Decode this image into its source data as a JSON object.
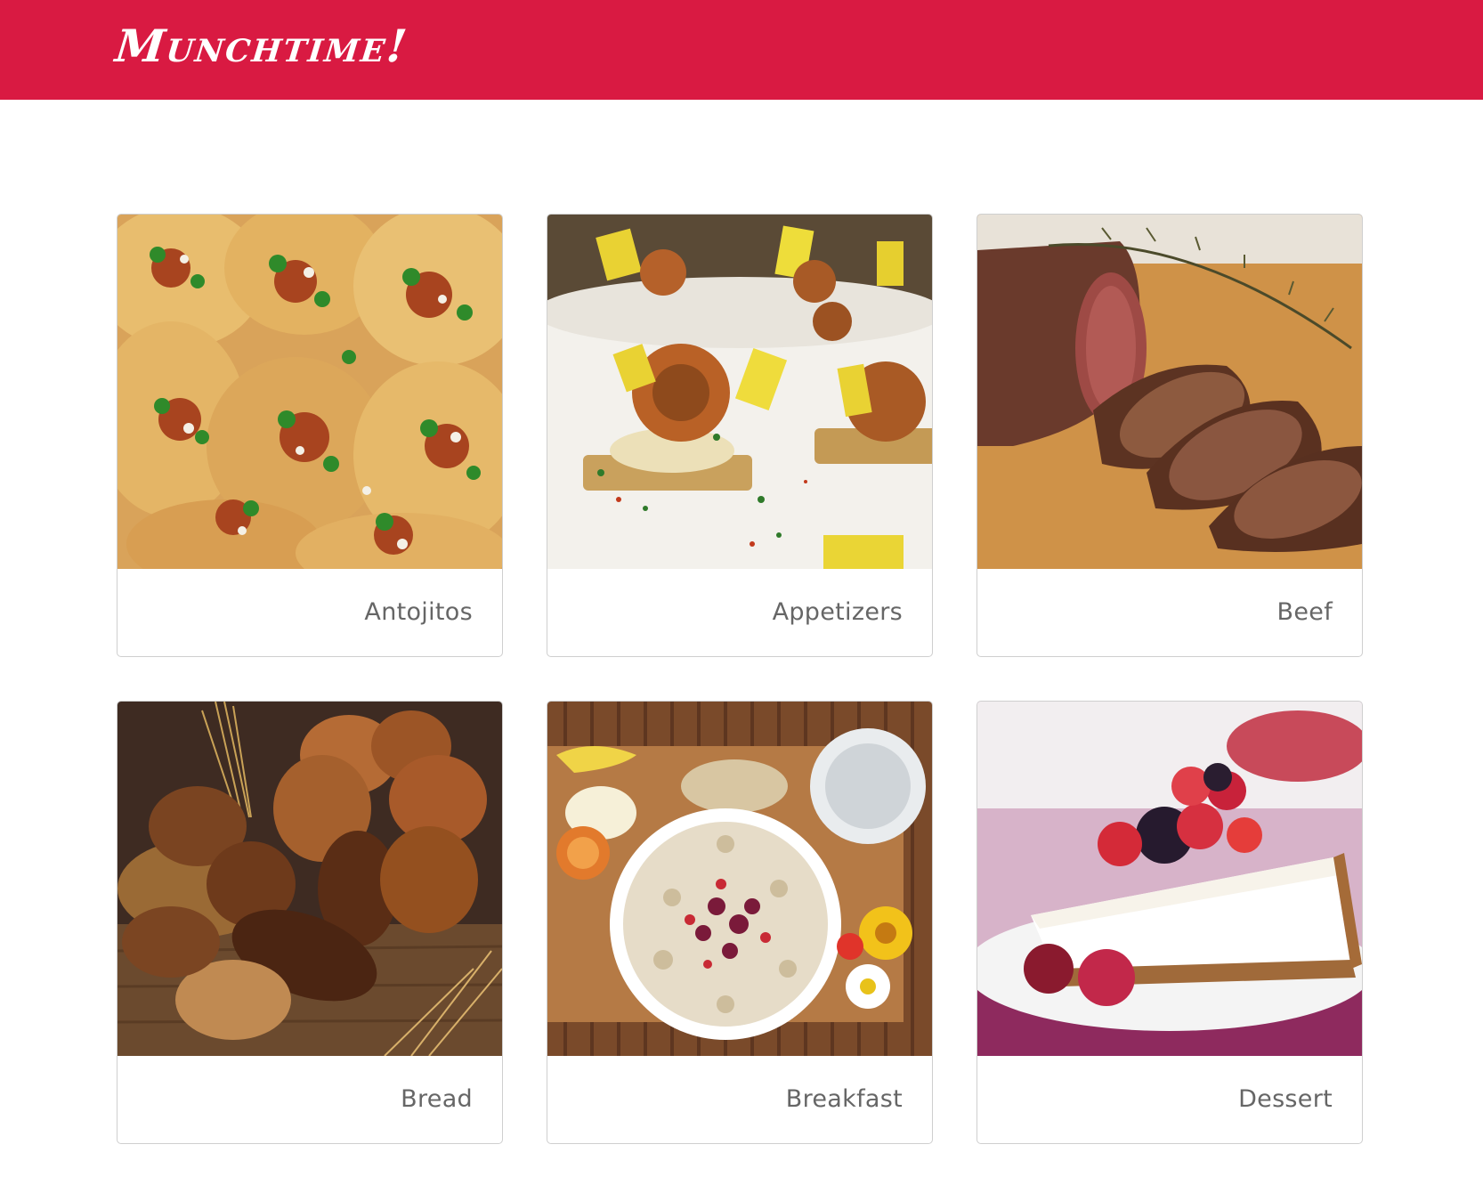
{
  "header": {
    "brand": "Munchtime!",
    "bar_color": "#d91a42"
  },
  "categories": [
    {
      "label": "Antojitos",
      "image": "tacos-photo"
    },
    {
      "label": "Appetizers",
      "image": "shrimp-appetizer-photo"
    },
    {
      "label": "Beef",
      "image": "beef-tenderloin-photo"
    },
    {
      "label": "Bread",
      "image": "bread-loaves-photo"
    },
    {
      "label": "Breakfast",
      "image": "oatmeal-breakfast-photo"
    },
    {
      "label": "Dessert",
      "image": "cheesecake-berries-photo"
    }
  ]
}
